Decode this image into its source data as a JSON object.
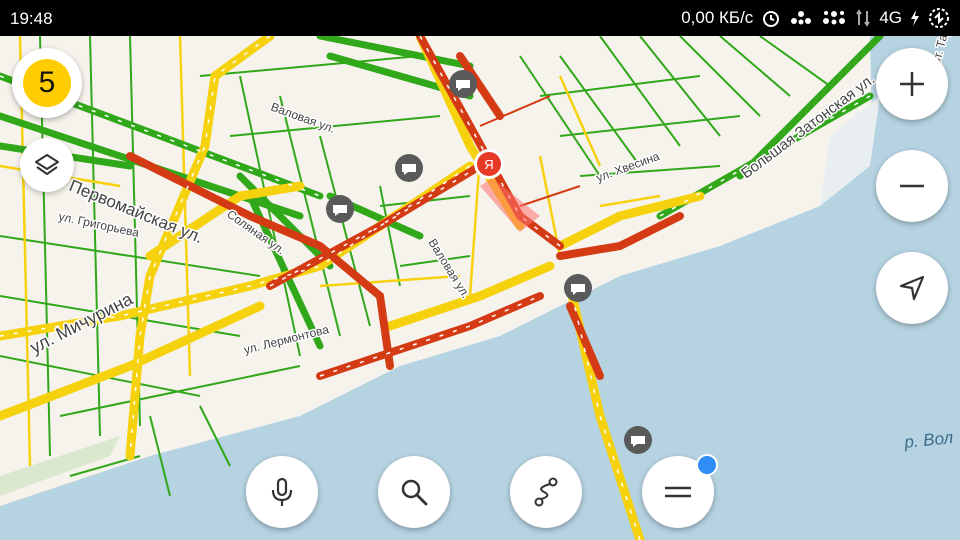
{
  "status_bar": {
    "time": "19:48",
    "network_speed": "0,00 КБ/с",
    "network_type": "4G",
    "icons": [
      "alarm-icon",
      "dots-icon",
      "dots-icon",
      "signal-icon",
      "charging-icon",
      "battery-icon"
    ]
  },
  "traffic": {
    "score": "5",
    "color": "#ffcc00"
  },
  "map": {
    "streets": [
      "Валовая ул.",
      "Первомайская ул.",
      "ул. Григорьева",
      "Соляная ул.",
      "ул. Мичурина",
      "ул. Лермонтова",
      "Валовая ул.",
      "ул. Хвесина",
      "Большая Затонская ул.",
      "прот. Тар"
    ],
    "river_label": "р. Вол",
    "pin_label": "Я",
    "colors": {
      "water": "#b6d3e2",
      "land": "#f6f3ec",
      "green": "#31a71a",
      "yellow": "#f5d20d",
      "red": "#d43b15",
      "pin": "#e63a27"
    }
  },
  "controls": {
    "zoom_in": "zoom-in-icon",
    "zoom_out": "zoom-out-icon",
    "locate": "locate-icon",
    "layers": "layers-icon",
    "voice": "microphone-icon",
    "search": "search-icon",
    "route": "route-icon",
    "menu": "menu-icon",
    "accent": "#2f8df5"
  }
}
